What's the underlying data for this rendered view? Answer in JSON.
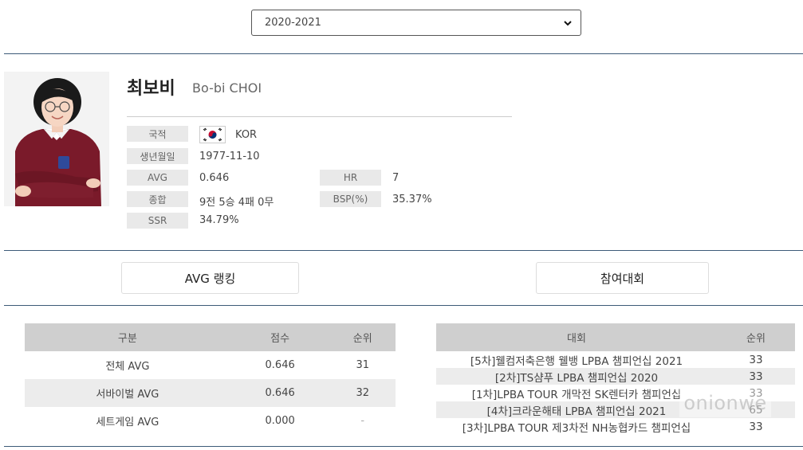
{
  "season_select": {
    "value": "2020-2021"
  },
  "player": {
    "name_ko": "최보비",
    "name_en": "Bo-bi CHOI",
    "stats": {
      "nationality_label": "국적",
      "nationality_value": "KOR",
      "birth_label": "생년월일",
      "birth_value": "1977-11-10",
      "avg_label": "AVG",
      "avg_value": "0.646",
      "record_label": "종합",
      "record_value": "9전 5승 4패 0무",
      "ssr_label": "SSR",
      "ssr_value": "34.79%",
      "hr_label": "HR",
      "hr_value": "7",
      "bsp_label": "BSP(%)",
      "bsp_value": "35.37%"
    }
  },
  "tabs": {
    "avg_ranking": "AVG 랭킹",
    "tournaments": "참여대회"
  },
  "avg_table": {
    "headers": [
      "구분",
      "점수",
      "순위"
    ],
    "rows": [
      [
        "전체 AVG",
        "0.646",
        "31"
      ],
      [
        "서바이벌 AVG",
        "0.646",
        "32"
      ],
      [
        "세트게임 AVG",
        "0.000",
        "-"
      ]
    ]
  },
  "tournament_table": {
    "headers": [
      "대회",
      "순위"
    ],
    "rows": [
      [
        "[5차]웰컴저축은행 웰뱅 LPBA 챔피언십 2021",
        "33"
      ],
      [
        "[2차]TS샴푸 LPBA 챔피언십 2020",
        "33"
      ],
      [
        "[1차]LPBA TOUR 개막전 SK렌터카 챔피언십",
        "33"
      ],
      [
        "[4차]크라운해태 LPBA 챔피언십 2021",
        "65"
      ],
      [
        "[3차]LPBA TOUR 제3차전 NH농협카드 챔피언십",
        "33"
      ]
    ]
  },
  "watermark": "onionwe",
  "colors": {
    "divider": "#3c5a78",
    "header_bg": "#cfcfcf",
    "label_bg": "#e9e9e9",
    "shirt": "#7a1a2a"
  },
  "icons": {
    "flag": "south-korea-flag-icon",
    "dropdown": "chevron-down-icon"
  }
}
